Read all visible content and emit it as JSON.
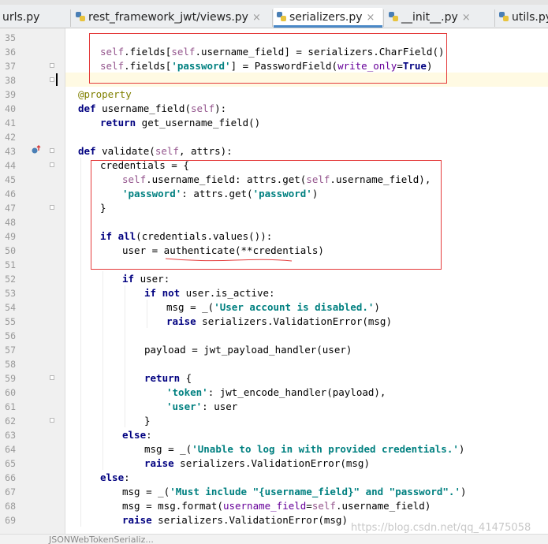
{
  "tabs": [
    {
      "name": "urls.py",
      "active": false
    },
    {
      "name": "rest_framework_jwt/views.py",
      "active": false
    },
    {
      "name": "serializers.py",
      "active": true
    },
    {
      "name": "__init__.py",
      "active": false
    },
    {
      "name": "utils.py",
      "active": false
    }
  ],
  "close_glyph": "×",
  "line_numbers": [
    "35",
    "36",
    "37",
    "38",
    "39",
    "40",
    "41",
    "42",
    "43",
    "44",
    "45",
    "46",
    "47",
    "48",
    "49",
    "50",
    "51",
    "52",
    "53",
    "54",
    "55",
    "56",
    "57",
    "58",
    "59",
    "60",
    "61",
    "62",
    "63",
    "64",
    "65",
    "66",
    "67",
    "68",
    "69"
  ],
  "watermark": "https://blog.csdn.net/qq_41475058",
  "status_text": "JSONWebTokenSerializ...",
  "colors": {
    "keyword": "#000080",
    "self": "#94558d",
    "string": "#008080",
    "decorator": "#808000",
    "kwarg": "#660099",
    "highlight_box": "#e43b3b",
    "active_tab_underline": "#4a88c7"
  },
  "icons": {
    "file": "python-file-icon",
    "close": "close-icon",
    "gutter_marker": "override-method-icon"
  }
}
